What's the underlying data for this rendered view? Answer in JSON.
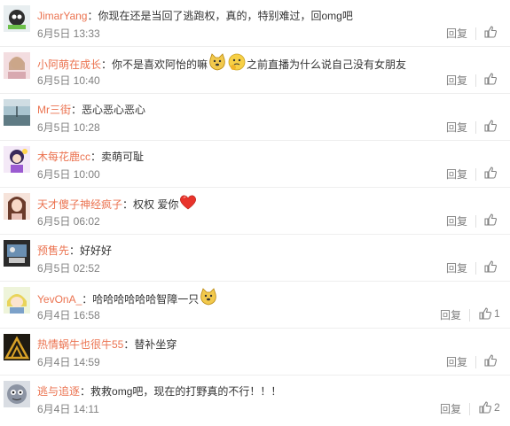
{
  "comments": [
    {
      "user": "JimarYang",
      "text": "你现在还是当回了逃跑权，真的，特别难过，回omg吧",
      "date": "6月5日 13:33",
      "reply": "回复",
      "likes": ""
    },
    {
      "user": "小阿萌在成长",
      "text": "你不是喜欢阿怡的嘛",
      "text2": "之前直播为什么说自己没有女朋友",
      "date": "6月5日 10:40",
      "reply": "回复",
      "likes": ""
    },
    {
      "user": "Mr三街",
      "text": "恶心恶心恶心",
      "date": "6月5日 10:28",
      "reply": "回复",
      "likes": ""
    },
    {
      "user": "木每花鹿cc",
      "text": "卖萌可耻",
      "date": "6月5日 10:00",
      "reply": "回复",
      "likes": ""
    },
    {
      "user": "天才傻子神经疯子",
      "text": "权权  爱你",
      "date": "6月5日 06:02",
      "reply": "回复",
      "likes": ""
    },
    {
      "user": "预售先",
      "text": "好好好",
      "date": "6月5日 02:52",
      "reply": "回复",
      "likes": ""
    },
    {
      "user": "YevOnA_",
      "text": "哈哈哈哈哈哈智障一只",
      "date": "6月4日 16:58",
      "reply": "回复",
      "likes": "1"
    },
    {
      "user": "热情蜗牛也很牛55",
      "text": "替补坐穿",
      "date": "6月4日 14:59",
      "reply": "回复",
      "likes": ""
    },
    {
      "user": "逃与追逐",
      "text": "救救omg吧，现在的打野真的不行！！！",
      "date": "6月4日 14:11",
      "reply": "回复",
      "likes": "2"
    }
  ],
  "colon": "：",
  "colors": {
    "username": "#eb7350",
    "text": "#333333",
    "meta": "#808080"
  }
}
